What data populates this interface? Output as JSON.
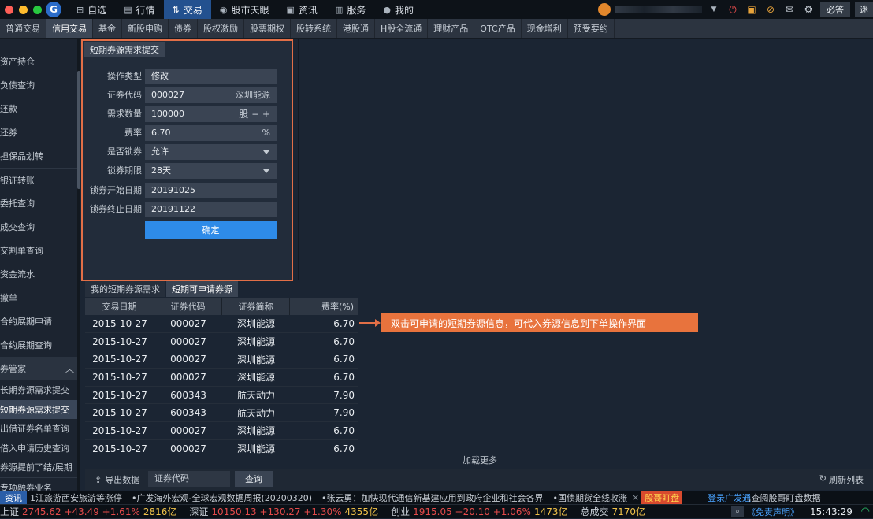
{
  "topbar": {
    "nav": [
      {
        "label": "自选",
        "icon": "plus-square-icon"
      },
      {
        "label": "行情",
        "icon": "chart-icon"
      },
      {
        "label": "交易",
        "icon": "trade-icon",
        "active": true
      },
      {
        "label": "股市天眼",
        "icon": "eye-icon"
      },
      {
        "label": "资讯",
        "icon": "news-icon"
      },
      {
        "label": "服务",
        "icon": "briefcase-icon"
      },
      {
        "label": "我的",
        "icon": "user-icon"
      }
    ],
    "btn_must_answer": "必答",
    "btn_fan": "迷"
  },
  "tabs": [
    "普通交易",
    "信用交易",
    "基金",
    "新股申购",
    "债券",
    "股权激励",
    "股票期权",
    "股转系统",
    "港股通",
    "H股全流通",
    "理财产品",
    "OTC产品",
    "现金增利",
    "预受要约"
  ],
  "active_tab": "信用交易",
  "sidebar": {
    "items": [
      "资产持仓",
      "负债查询",
      "还款",
      "还券",
      "担保品划转",
      "银证转账",
      "委托查询",
      "成交查询",
      "交割单查询",
      "资金流水",
      "撤单",
      "合约展期申请",
      "合约展期查询"
    ],
    "group": "券管家",
    "sub_items": [
      "长期券源需求提交",
      "短期券源需求提交",
      "出借证券名单查询",
      "借入申请历史查询",
      "券源提前了结/展期"
    ],
    "selected": "短期券源需求提交",
    "more": "专项融券业务"
  },
  "form": {
    "title": "短期券源需求提交",
    "rows": [
      {
        "label": "操作类型",
        "value": "修改",
        "right": ""
      },
      {
        "label": "证券代码",
        "value": "000027",
        "right": "深圳能源"
      },
      {
        "label": "需求数量",
        "value": "100000",
        "right": "股 − +"
      },
      {
        "label": "费率",
        "value": "6.70",
        "right": "%"
      },
      {
        "label": "是否锁券",
        "value": "允许",
        "right": ""
      },
      {
        "label": "锁券期限",
        "value": "28天",
        "right": ""
      },
      {
        "label": "锁券开始日期",
        "value": "20191025",
        "right": ""
      },
      {
        "label": "锁券终止日期",
        "value": "20191122",
        "right": ""
      }
    ],
    "confirm": "确定"
  },
  "lower_tabs": [
    "我的短期券源需求",
    "短期可申请券源"
  ],
  "table": {
    "headers": [
      "交易日期",
      "证券代码",
      "证券简称",
      "费率(%)"
    ],
    "rows": [
      [
        "2015-10-27",
        "000027",
        "深圳能源",
        "6.70"
      ],
      [
        "2015-10-27",
        "000027",
        "深圳能源",
        "6.70"
      ],
      [
        "2015-10-27",
        "000027",
        "深圳能源",
        "6.70"
      ],
      [
        "2015-10-27",
        "000027",
        "深圳能源",
        "6.70"
      ],
      [
        "2015-10-27",
        "600343",
        "航天动力",
        "7.90"
      ],
      [
        "2015-10-27",
        "600343",
        "航天动力",
        "7.90"
      ],
      [
        "2015-10-27",
        "000027",
        "深圳能源",
        "6.70"
      ],
      [
        "2015-10-27",
        "000027",
        "深圳能源",
        "6.70"
      ]
    ],
    "load_more": "加载更多"
  },
  "annotation": "双击可申请的短期券源信息，可代入券源信息到下单操作界面",
  "bottombar": {
    "export": "导出数据",
    "code_placeholder": "证券代码",
    "query": "查询",
    "refresh": "刷新列表"
  },
  "ticker": {
    "tag": "资讯",
    "items": [
      "1江旅游西安旅游等涨停",
      "•广发海外宏观-全球宏观数据周报(20200320)",
      "•张云勇：加快现代通信新基建应用到政府企业和社会各界",
      "•国债期货全线收涨"
    ],
    "badge": "股哥盯盘",
    "link": "登录广发通",
    "suffix": ",查阅股哥盯盘数据"
  },
  "status": {
    "sh_label": "上证",
    "sh": "2745.62 +43.49 +1.61%",
    "sh_amt": "2816亿",
    "sz_label": "深证",
    "sz": "10150.13 +130.27 +1.30%",
    "sz_amt": "4355亿",
    "cy_label": "创业",
    "cy": "1915.05 +20.10 +1.06%",
    "cy_amt": "1473亿",
    "total_label": "总成交",
    "total": "7170亿",
    "disclaimer": "《免责声明》",
    "time": "15:43:29"
  }
}
